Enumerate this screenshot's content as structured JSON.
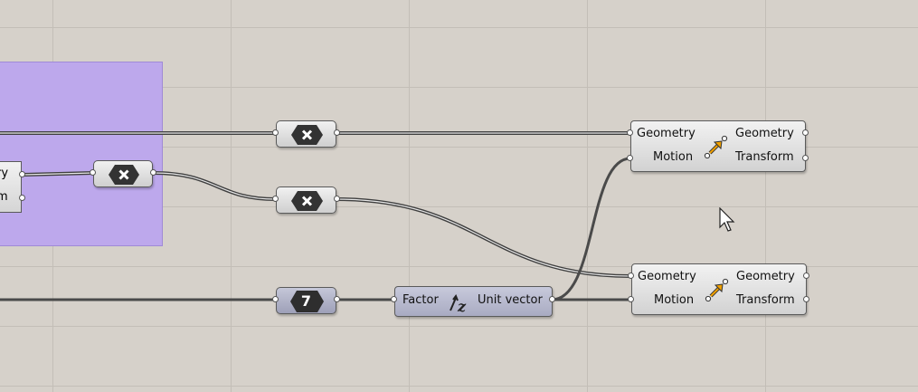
{
  "canvas": {
    "background": "#d6d1ca",
    "group_color": "#bda8ec",
    "wire_color": "#3f3f3f"
  },
  "edge_component": {
    "output_1": "ry",
    "output_2": "m"
  },
  "relays": [
    {
      "name": "relay-1",
      "icon": "x-hexagon-icon"
    },
    {
      "name": "relay-2",
      "icon": "x-hexagon-icon"
    },
    {
      "name": "relay-3",
      "icon": "x-hexagon-icon"
    }
  ],
  "number_param": {
    "value": "7",
    "icon": "hexagon-number-icon"
  },
  "unit_z": {
    "input_label": "Factor",
    "output_label": "Unit vector",
    "icon": "unit-z-icon"
  },
  "move_components": [
    {
      "input_1": "Geometry",
      "input_2": "Motion",
      "output_1": "Geometry",
      "output_2": "Transform",
      "icon": "move-arrow-icon"
    },
    {
      "input_1": "Geometry",
      "input_2": "Motion",
      "output_1": "Geometry",
      "output_2": "Transform",
      "icon": "move-arrow-icon"
    }
  ]
}
